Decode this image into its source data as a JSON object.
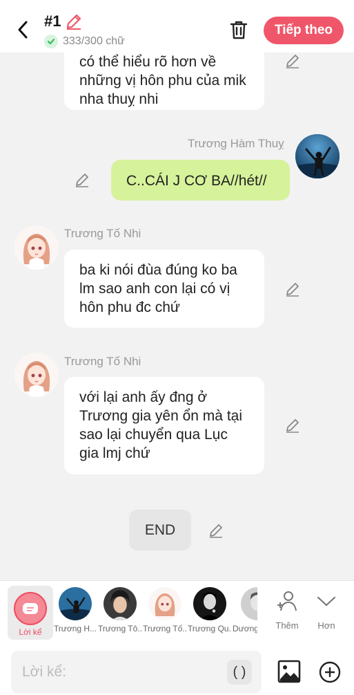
{
  "header": {
    "title": "#1",
    "word_count": "333/300 chữ",
    "next_label": "Tiếp theo",
    "accent_color": "#f0566a"
  },
  "messages": [
    {
      "side": "left",
      "text": "có thể hiểu rõ hơn về những vị hôn phu của mik nha thuỵ nhi"
    },
    {
      "side": "right",
      "name": "Trương Hàm Thuỵ",
      "text": "C..CÁI J CƠ BA//hét//"
    },
    {
      "side": "left",
      "name": "Trương Tố Nhi",
      "text": "ba ki nói đùa đúng ko ba lm sao anh con lại có vị hôn phu đc chứ"
    },
    {
      "side": "left",
      "name": "Trương Tố Nhi",
      "text": "với lại anh ấy đng ở Trương gia yên ổn mà tại sao lại chuyển qua Lục gia lmj chứ"
    }
  ],
  "end_label": "END",
  "characters": {
    "narrator_label": "Lời kể",
    "items": [
      {
        "label": "Trương H..."
      },
      {
        "label": "Trương Tô..."
      },
      {
        "label": "Trương Tố..."
      },
      {
        "label": "Trương Qu..."
      },
      {
        "label": "Dương"
      }
    ],
    "add_label": "Thêm",
    "more_label": "Hơn"
  },
  "input": {
    "placeholder": "Lời kể:",
    "paren_label": "( )"
  }
}
